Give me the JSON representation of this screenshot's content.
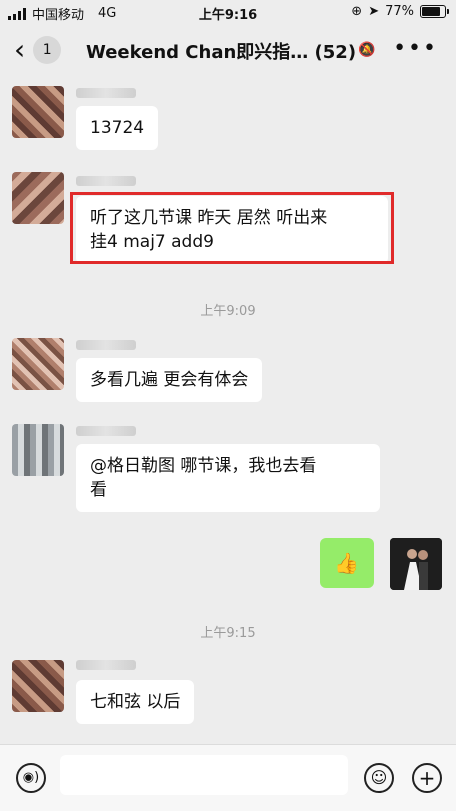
{
  "status_bar": {
    "carrier": "中国移动",
    "network": "4G",
    "time": "上午9:16",
    "battery": "77%"
  },
  "nav": {
    "back_count": "1",
    "title": "Weekend Chan即兴指… (52)"
  },
  "messages": [
    {
      "text": "13724"
    },
    {
      "text_line1": "听了这几节课 昨天 居然 听出来",
      "text_line2": "挂4 maj7 add9"
    },
    {
      "text": "多看几遍 更会有体会"
    },
    {
      "text_line1": "@格日勒图 哪节课，我也去看",
      "text_line2": "看"
    },
    {
      "text": "👍",
      "sender": "me"
    },
    {
      "text": "七和弦 以后"
    }
  ],
  "timestamps": [
    "上午9:09",
    "上午9:15"
  ],
  "icons": {
    "back": "chevron-left-icon",
    "mute": "mute-bell-icon",
    "more": "more-icon",
    "voice": "voice-icon",
    "emoji": "emoji-icon",
    "add": "plus-icon"
  },
  "colors": {
    "my_bubble": "#95ec69",
    "highlight_box": "#e02a2a",
    "background": "#ededed"
  }
}
